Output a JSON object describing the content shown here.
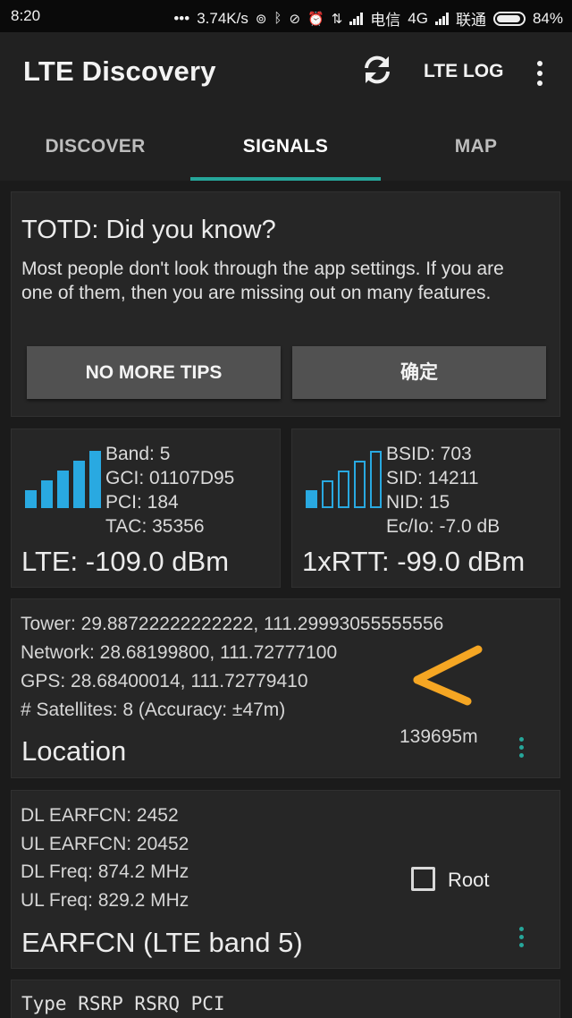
{
  "status_bar": {
    "time": "8:20",
    "dots": "•••",
    "speed": "3.74K/s",
    "carrier1": "电信",
    "network_type": "4G",
    "carrier2": "联通",
    "battery": "84%"
  },
  "app_bar": {
    "title": "LTE Discovery",
    "refresh_icon": "refresh-icon",
    "lte_log_label": "LTE LOG",
    "overflow_icon": "more-vert-icon"
  },
  "tabs": [
    {
      "label": "DISCOVER",
      "active": false
    },
    {
      "label": "SIGNALS",
      "active": true
    },
    {
      "label": "MAP",
      "active": false
    }
  ],
  "accent_color": "#26a69a",
  "signal_color": "#29a9e1",
  "totd": {
    "title": "TOTD: Did you know?",
    "body": "Most people don't look through the app settings. If you are one of them, then you are missing out on many features.",
    "no_more_tips_label": "NO MORE TIPS",
    "ok_label": "确定"
  },
  "lte_card": {
    "lines": [
      "Band: 5",
      "GCI: 01107D95",
      "PCI: 184",
      "TAC: 35356"
    ],
    "reading": "LTE: -109.0 dBm",
    "bars_filled": 5,
    "bars_total": 5
  },
  "rtt_card": {
    "lines": [
      "BSID: 703",
      "SID: 14211",
      "NID: 15",
      "Ec/Io: -7.0 dB"
    ],
    "reading": "1xRTT: -99.0 dBm",
    "bars_filled": 1,
    "bars_total": 5
  },
  "location_card": {
    "lines": [
      "Tower: 29.88722222222222, 111.29993055555556",
      "Network: 28.68199800, 111.72777100",
      "GPS: 28.68400014, 111.72779410",
      "# Satellites: 8 (Accuracy: ±47m)"
    ],
    "distance": "139695m",
    "label": "Location",
    "arrow_icon": "orange-arrow-icon",
    "arrow_color": "#f5a623"
  },
  "earfcn_card": {
    "lines": [
      "DL EARFCN: 2452",
      "UL EARFCN: 20452",
      "DL Freq: 874.2 MHz",
      "UL Freq: 829.2 MHz"
    ],
    "root_label": "Root",
    "root_checked": false,
    "label": "EARFCN (LTE band 5)"
  },
  "neighbor_card": {
    "header": "Type RSRP RSRQ PCI"
  }
}
